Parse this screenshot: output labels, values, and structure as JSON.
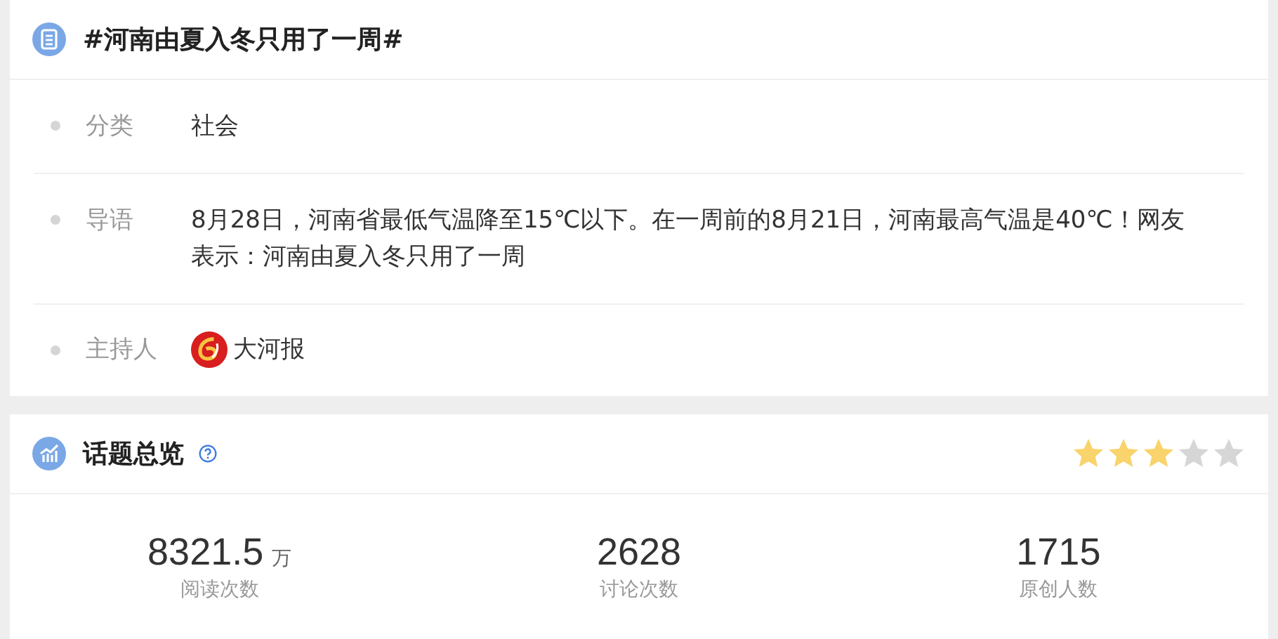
{
  "topic": {
    "title": "#河南由夏入冬只用了一周#",
    "fields": [
      {
        "kind": "text",
        "label": "分类",
        "value": "社会"
      },
      {
        "kind": "text",
        "label": "导语",
        "value": "8月28日，河南省最低气温降至15℃以下。在一周前的8月21日，河南最高气温是40℃！网友表示：河南由夏入冬只用了一周"
      },
      {
        "kind": "host",
        "label": "主持人",
        "value": "大河报"
      }
    ]
  },
  "overview": {
    "title": "话题总览",
    "stars": 3,
    "stats": [
      {
        "value": "8321.5",
        "unit": "万",
        "label": "阅读次数"
      },
      {
        "value": "2628",
        "label": "讨论次数"
      },
      {
        "value": "1715",
        "label": "原创人数"
      }
    ]
  }
}
